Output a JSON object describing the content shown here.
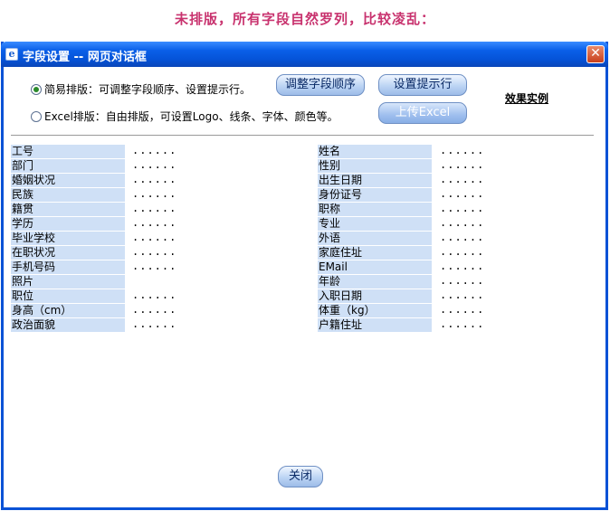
{
  "caption": "未排版，所有字段自然罗列，比较凌乱：",
  "window": {
    "title": "字段设置 -- 网页对话框",
    "icon": "ie-page-icon",
    "close_glyph": "✕"
  },
  "options": {
    "simple": {
      "label": "简易排版：可调整字段顺序、设置提示行。",
      "checked": true
    },
    "excel": {
      "label": "Excel排版：自由排版，可设置Logo、线条、字体、颜色等。",
      "checked": false
    }
  },
  "buttons": {
    "adjust_order": "调整字段顺序",
    "set_prompt": "设置提示行",
    "upload_excel": "上传Excel",
    "close": "关闭"
  },
  "example_link": "效果实例",
  "fields": [
    {
      "left": "工号",
      "left_value": "......",
      "right": "姓名",
      "right_value": "......"
    },
    {
      "left": "部门",
      "left_value": "......",
      "right": "性别",
      "right_value": "......"
    },
    {
      "left": "婚姻状况",
      "left_value": "......",
      "right": "出生日期",
      "right_value": "......"
    },
    {
      "left": "民族",
      "left_value": "......",
      "right": "身份证号",
      "right_value": "......"
    },
    {
      "left": "籍贯",
      "left_value": "......",
      "right": "职称",
      "right_value": "......"
    },
    {
      "left": "学历",
      "left_value": "......",
      "right": "专业",
      "right_value": "......"
    },
    {
      "left": "毕业学校",
      "left_value": "......",
      "right": "外语",
      "right_value": "......"
    },
    {
      "left": "在职状况",
      "left_value": "......",
      "right": "家庭住址",
      "right_value": "......"
    },
    {
      "left": "手机号码",
      "left_value": "......",
      "right": "EMail",
      "right_value": "......"
    },
    {
      "left": "照片",
      "left_value": "",
      "right": "年龄",
      "right_value": "......"
    },
    {
      "left": "职位",
      "left_value": "......",
      "right": "入职日期",
      "right_value": "......"
    },
    {
      "left": "身高（cm）",
      "left_value": "......",
      "right": "体重（kg）",
      "right_value": "......"
    },
    {
      "left": "政治面貌",
      "left_value": "......",
      "right": "户籍住址",
      "right_value": "......"
    }
  ]
}
